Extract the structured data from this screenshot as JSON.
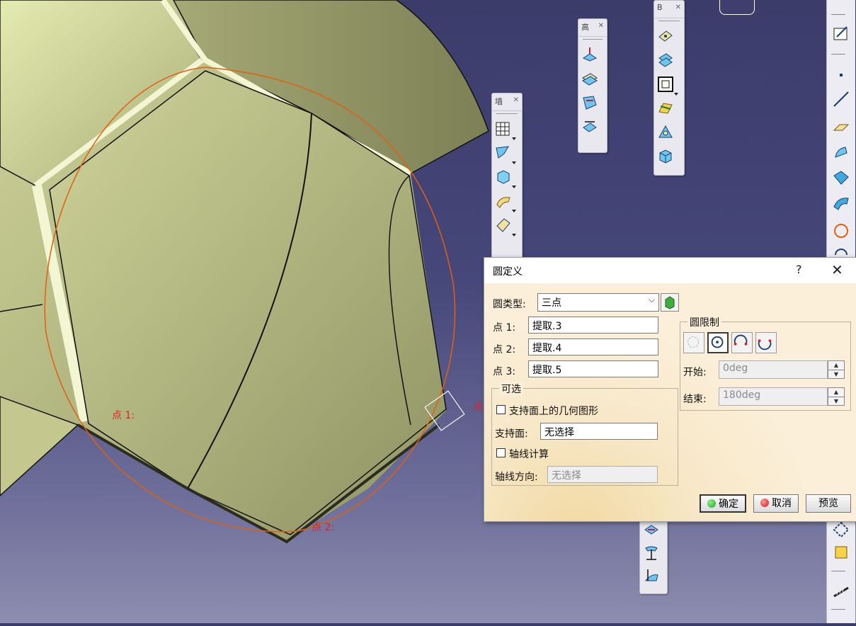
{
  "viewport": {
    "annotations": {
      "point1": "点 1:",
      "point2": "点 2:",
      "point3_partial": "点"
    }
  },
  "toolbars": {
    "toolbar_a": {
      "title": "墙"
    },
    "toolbar_b": {
      "title": "高"
    },
    "toolbar_c": {
      "title": "B"
    }
  },
  "dialog": {
    "title": "圆定义",
    "help": "?",
    "close": "✕",
    "circle_type_label": "圆类型:",
    "circle_type_value": "三点",
    "point1_label": "点 1:",
    "point1_value": "提取.3",
    "point2_label": "点 2:",
    "point2_value": "提取.4",
    "point3_label": "点 3:",
    "point3_value": "提取.5",
    "optional": {
      "title": "可选",
      "geometry_on_support_label": "支持面上的几何图形",
      "geometry_on_support_checked": false,
      "support_label": "支持面:",
      "support_value": "无选择",
      "axis_compute_label": "轴线计算",
      "axis_compute_checked": false,
      "axis_direction_label": "轴线方向:",
      "axis_direction_placeholder": "无选择"
    },
    "circle_limits": {
      "title": "圆限制",
      "start_label": "开始:",
      "start_value": "0deg",
      "end_label": "结束:",
      "end_value": "180deg"
    },
    "buttons": {
      "ok": "确定",
      "cancel": "取消",
      "preview": "预览"
    }
  },
  "colors": {
    "background_top": "#3b3c6a",
    "surface": "#b8bc80",
    "construction_circle": "#e06010",
    "annotation_red": "#e02020",
    "ok_green": "#1aa81a",
    "cancel_red": "#d01818"
  }
}
